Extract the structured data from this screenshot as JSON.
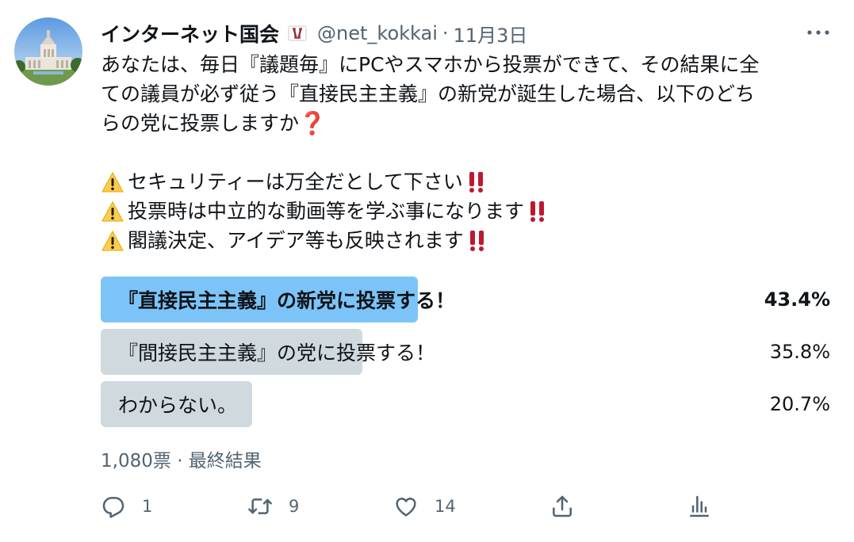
{
  "tweet": {
    "display_name": "インターネット国会",
    "handle": "@net_kokkai",
    "separator": "·",
    "date": "11月3日",
    "text_lines": [
      "あなたは、毎日『議題毎』にPCやスマホから投票ができて、その結果に全",
      "ての議員が必ず従う『直接民主主義』の新党が誕生した場合、以下のどち",
      "らの党に投票しますか"
    ],
    "notes": [
      "セキュリティーは万全だとして下さい",
      "投票時は中立的な動画等を学ぶ事になります",
      "閣議決定、アイデア等も反映されます"
    ],
    "question_emoji": "❓",
    "warning_emoji": "⚠",
    "double_exclamation_emoji": "‼"
  },
  "poll": {
    "options": [
      {
        "label": "『直接民主主義』の新党に投票する！",
        "percent": "43.4%",
        "fraction": 0.434,
        "winner": true
      },
      {
        "label": "『間接民主主義』の党に投票する！",
        "percent": "35.8%",
        "fraction": 0.358,
        "winner": false
      },
      {
        "label": "わからない。",
        "percent": "20.7%",
        "fraction": 0.207,
        "winner": false
      }
    ],
    "votes": "1,080票",
    "meta_separator": "·",
    "status": "最終結果"
  },
  "actions": {
    "reply_count": "1",
    "retweet_count": "9",
    "like_count": "14"
  },
  "colors": {
    "winner_bar": "#7cc4f8",
    "other_bar": "#cfd9de",
    "muted_text": "#536471",
    "main_text": "#0f1419"
  },
  "icons": [
    "more-icon",
    "reply-icon",
    "retweet-icon",
    "like-icon",
    "share-icon",
    "analytics-icon",
    "warning-icon",
    "double-exclamation-icon",
    "question-icon",
    "verified-badge-icon"
  ]
}
